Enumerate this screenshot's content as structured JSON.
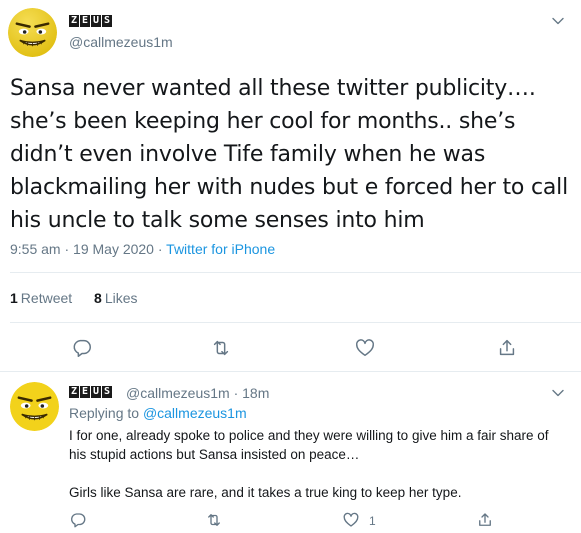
{
  "main_tweet": {
    "display_name_letters": [
      "Z",
      "E",
      "U",
      "S"
    ],
    "handle": "@callmezeus1m",
    "text": "Sansa never wanted all these twitter publicity…. she’s been keeping her cool for months.. she’s didn’t even involve Tife family when he was blackmailing her with nudes but e forced her to call his uncle to talk some senses into him",
    "time": "9:55 am · 19 May 2020 · ",
    "source": "Twitter for iPhone",
    "retweet_count": "1",
    "retweet_label": "Retweet",
    "like_count": "8",
    "like_label": "Likes"
  },
  "reply_tweet": {
    "display_name_letters": [
      "Z",
      "E",
      "U",
      "S"
    ],
    "handle_time": "@callmezeus1m · 18m",
    "replying_prefix": "Replying to ",
    "replying_handle": "@callmezeus1m",
    "paragraph_1": "I for one, already spoke to police and they were willing to give him a fair share of his stupid actions but Sansa insisted on peace…",
    "paragraph_2": "Girls like Sansa are rare, and it takes a true king to keep her type.",
    "like_count": "1"
  },
  "icons": {
    "reply": "reply-icon",
    "retweet": "retweet-icon",
    "like": "heart-icon",
    "share": "share-icon",
    "menu": "chevron-down-icon"
  },
  "colors": {
    "link": "#1b95e0",
    "secondary": "#657786",
    "divider": "#e6ecf0",
    "avatar_yellow": "#f2d21b"
  }
}
